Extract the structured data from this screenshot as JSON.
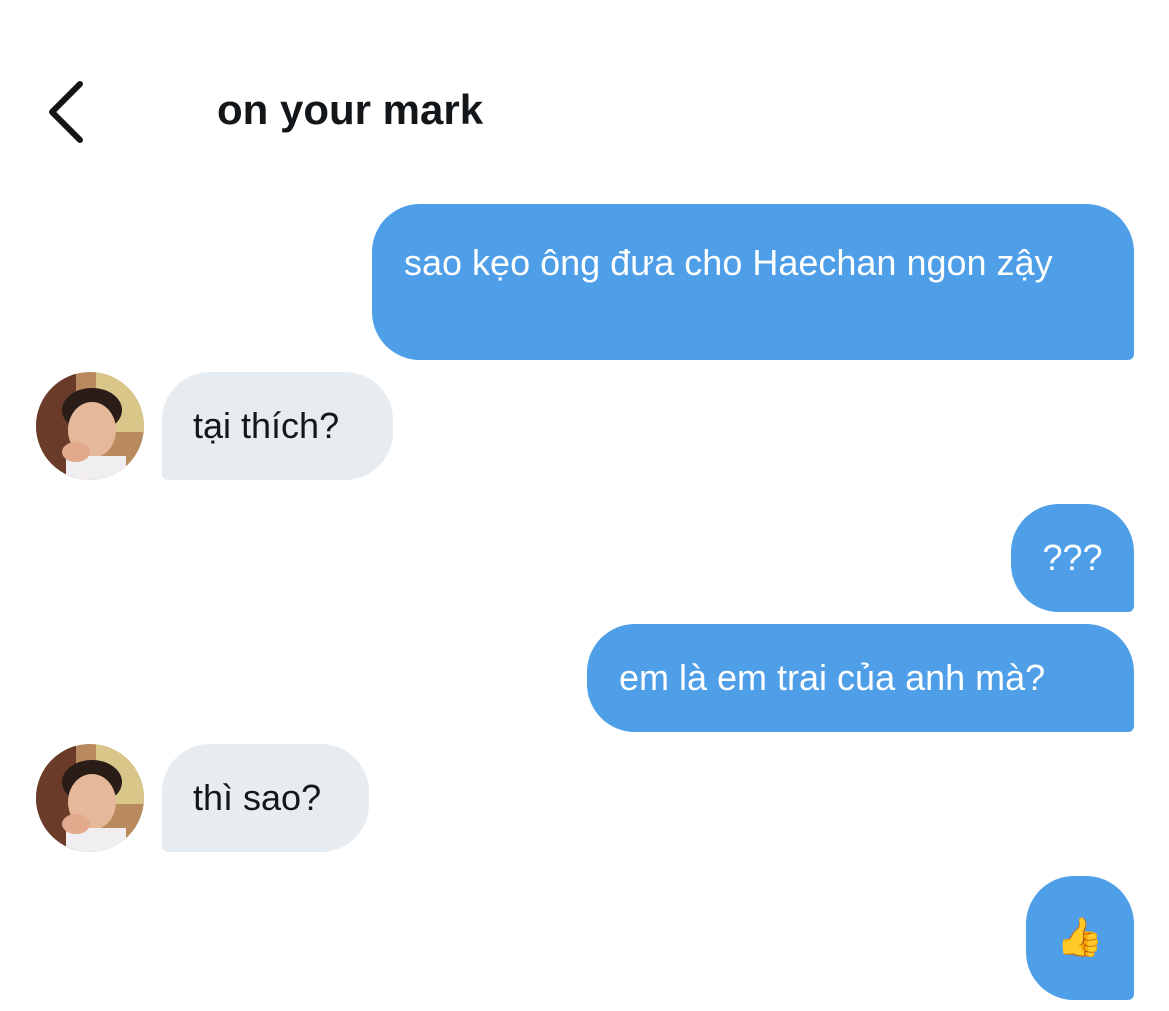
{
  "header": {
    "title": "on your mark",
    "back_icon": "chevron-left-icon"
  },
  "messages": [
    {
      "direction": "outgoing",
      "text": "sao kẹo ông đưa cho Haechan ngon zậy"
    },
    {
      "direction": "incoming",
      "text": "tại thích?",
      "avatar": "user-avatar"
    },
    {
      "direction": "outgoing",
      "text": "???"
    },
    {
      "direction": "outgoing",
      "text": "em là em trai của anh mà?"
    },
    {
      "direction": "incoming",
      "text": "thì sao?",
      "avatar": "user-avatar"
    },
    {
      "direction": "outgoing",
      "emoji": "thumbs-up",
      "text": "👍"
    }
  ],
  "colors": {
    "outgoing_bubble": "#4e9fe8",
    "incoming_bubble": "#e7ecf0",
    "title_text": "#14171a"
  }
}
